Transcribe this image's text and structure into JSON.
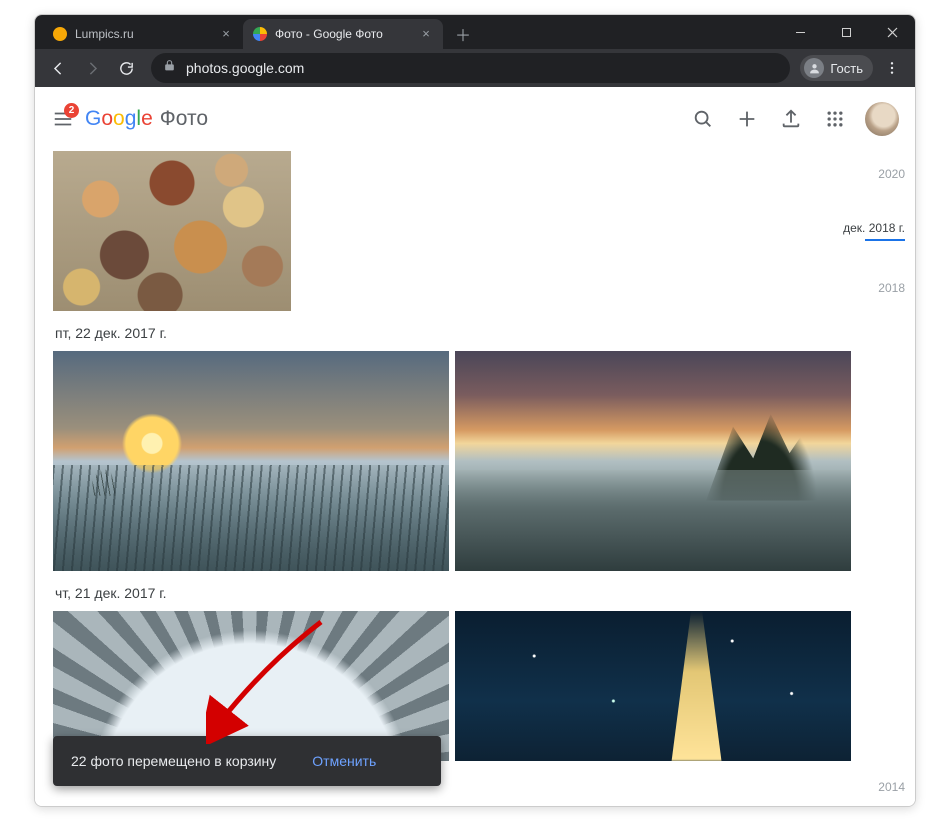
{
  "browser": {
    "tabs": [
      {
        "title": "Lumpics.ru",
        "favicon_color": "#f7a807",
        "active": false
      },
      {
        "title": "Фото - Google Фото",
        "favicon_color": "#4285F4",
        "active": true
      }
    ],
    "url": "photos.google.com",
    "profile_label": "Гость"
  },
  "header": {
    "badge_count": "2",
    "logo_letters": [
      "G",
      "o",
      "o",
      "g",
      "l",
      "e"
    ],
    "product": "Фото"
  },
  "timeline": {
    "year_top": "2020",
    "month": "дек. 2018 г.",
    "year_mid": "2018",
    "year_bottom": "2014"
  },
  "groups": [
    {
      "date": "пт, 22 дек. 2017 г."
    },
    {
      "date": "чт, 21 дек. 2017 г."
    }
  ],
  "toast": {
    "message": "22 фото перемещено в корзину",
    "action": "Отменить"
  }
}
